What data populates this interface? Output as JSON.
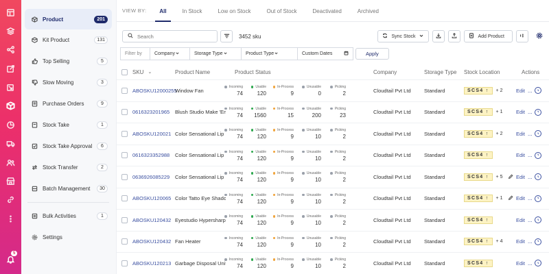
{
  "rail": {
    "icons": [
      "dashboard-icon",
      "layers-icon",
      "share-icon",
      "external-link-icon",
      "pick-icon",
      "inventory-box-icon",
      "pie-chart-icon",
      "truck-icon",
      "users-icon",
      "store-icon",
      "link-icon",
      "more-dots-icon"
    ],
    "notification_count": "5"
  },
  "sidebar": {
    "items": [
      {
        "label": "Product",
        "count": "201",
        "icon": "box-icon"
      },
      {
        "label": "Kit Product",
        "count": "131",
        "icon": "kit-icon"
      },
      {
        "label": "Top Selling",
        "count": "5",
        "icon": "thumbs-up-icon"
      },
      {
        "label": "Slow Moving",
        "count": "3",
        "icon": "thumbs-down-icon"
      },
      {
        "label": "Purchase Orders",
        "count": "9",
        "icon": "purchase-order-icon"
      },
      {
        "label": "Stock Take",
        "count": "1",
        "icon": "stock-take-icon"
      },
      {
        "label": "Stock Take Approval",
        "count": "6",
        "icon": "approval-icon"
      },
      {
        "label": "Stock Transfer",
        "count": "2",
        "icon": "transfer-icon"
      },
      {
        "label": "Batch Management",
        "count": "30",
        "icon": "batch-icon"
      }
    ],
    "bottom": [
      {
        "label": "Bulk Activities",
        "count": "1",
        "icon": "bulk-icon"
      },
      {
        "label": "Settings",
        "icon": "settings-icon"
      }
    ]
  },
  "viewby": {
    "label": "VIEW BY:",
    "tabs": [
      "All",
      "In Stock",
      "Low on Stock",
      "Out of Stock",
      "Deactivated",
      "Archived"
    ]
  },
  "toolbar": {
    "search_placeholder": "Search",
    "sku_count": "3452 sku",
    "sync_label": "Sync Stock",
    "add_label": "Add Product"
  },
  "filters": {
    "label": "Filter by",
    "company": "Company",
    "storage_type": "Storage Type",
    "product_type": "Product Type",
    "custom_dates": "Custom Dates",
    "apply": "Apply"
  },
  "table": {
    "headers": {
      "sku": "SKU",
      "name": "Product Name",
      "product": "Product",
      "status": "Status",
      "company": "Company",
      "storage": "Storage Type",
      "location": "Stock Location",
      "actions": "Actions"
    },
    "status_labels": [
      "Incoming",
      "Usable",
      "In-Process",
      "Unusable",
      "Picking"
    ],
    "status_colors": [
      "#9aa0aa",
      "#2fa84f",
      "#f0a33a",
      "#9aa0aa",
      "#9aa0aa"
    ],
    "edit_label": "Edit",
    "more_label": "...",
    "rows": [
      {
        "sku": "ABOSKU12000255",
        "name": "Window Fan",
        "stats": [
          "74",
          "120",
          "9",
          "0",
          "2"
        ],
        "company": "Cloudtail Pvt Ltd",
        "storage": "Standard",
        "location": "SCS4 ↑",
        "extra": "+ 2",
        "edit_icon": false
      },
      {
        "sku": "0616323201965",
        "name": "Blush Studio Make 'Em…",
        "stats": [
          "74",
          "1560",
          "15",
          "200",
          "23"
        ],
        "company": "Cloudtail Pvt Ltd",
        "storage": "Standard",
        "location": "SCS4 ↑",
        "extra": "+ 1",
        "edit_icon": false
      },
      {
        "sku": "ABOSKU120021",
        "name": "Color Sensational Lip …",
        "stats": [
          "74",
          "120",
          "9",
          "10",
          "2"
        ],
        "company": "Cloudtail Pvt Ltd",
        "storage": "Standard",
        "location": "SCS4 ↑",
        "extra": "+ 2",
        "edit_icon": false
      },
      {
        "sku": "0616323352988",
        "name": "Color Sensational Lip …",
        "stats": [
          "74",
          "120",
          "9",
          "10",
          "2"
        ],
        "company": "Cloudtail Pvt Ltd",
        "storage": "Standard",
        "location": "SCS4 ↑",
        "extra": "",
        "edit_icon": false
      },
      {
        "sku": "0636926085229",
        "name": "Color Sensational Lip …",
        "stats": [
          "74",
          "120",
          "9",
          "10",
          "2"
        ],
        "company": "Cloudtail Pvt Ltd",
        "storage": "Standard",
        "location": "SCS4 ↑",
        "extra": "+ 5",
        "edit_icon": true
      },
      {
        "sku": "ABOSKU120065",
        "name": "Color Tatto Eye Shadow",
        "stats": [
          "74",
          "120",
          "9",
          "10",
          "2"
        ],
        "company": "Cloudtail Pvt Ltd",
        "storage": "Standard",
        "location": "SCS4 ↑",
        "extra": "+ 1",
        "edit_icon": true
      },
      {
        "sku": "ABOSKU120432",
        "name": "Eyestudio Hypersharp…",
        "stats": [
          "74",
          "120",
          "9",
          "10",
          "2"
        ],
        "company": "Cloudtail Pvt Ltd",
        "storage": "Standard",
        "location": "SCS4 ↑",
        "extra": "",
        "edit_icon": false
      },
      {
        "sku": "ABOSKU120432",
        "name": "Fan Heater",
        "stats": [
          "74",
          "120",
          "9",
          "10",
          "2"
        ],
        "company": "Cloudtail Pvt Ltd",
        "storage": "Standard",
        "location": "SCS4 ↑",
        "extra": "+ 4",
        "edit_icon": false
      },
      {
        "sku": "ABOSKU120213",
        "name": "Garbage Disposal Unit",
        "stats": [
          "74",
          "120",
          "9",
          "10",
          "2"
        ],
        "company": "Cloudtail Pvt Ltd",
        "storage": "Standard",
        "location": "SCS4 ↑",
        "extra": "",
        "edit_icon": false
      }
    ]
  }
}
